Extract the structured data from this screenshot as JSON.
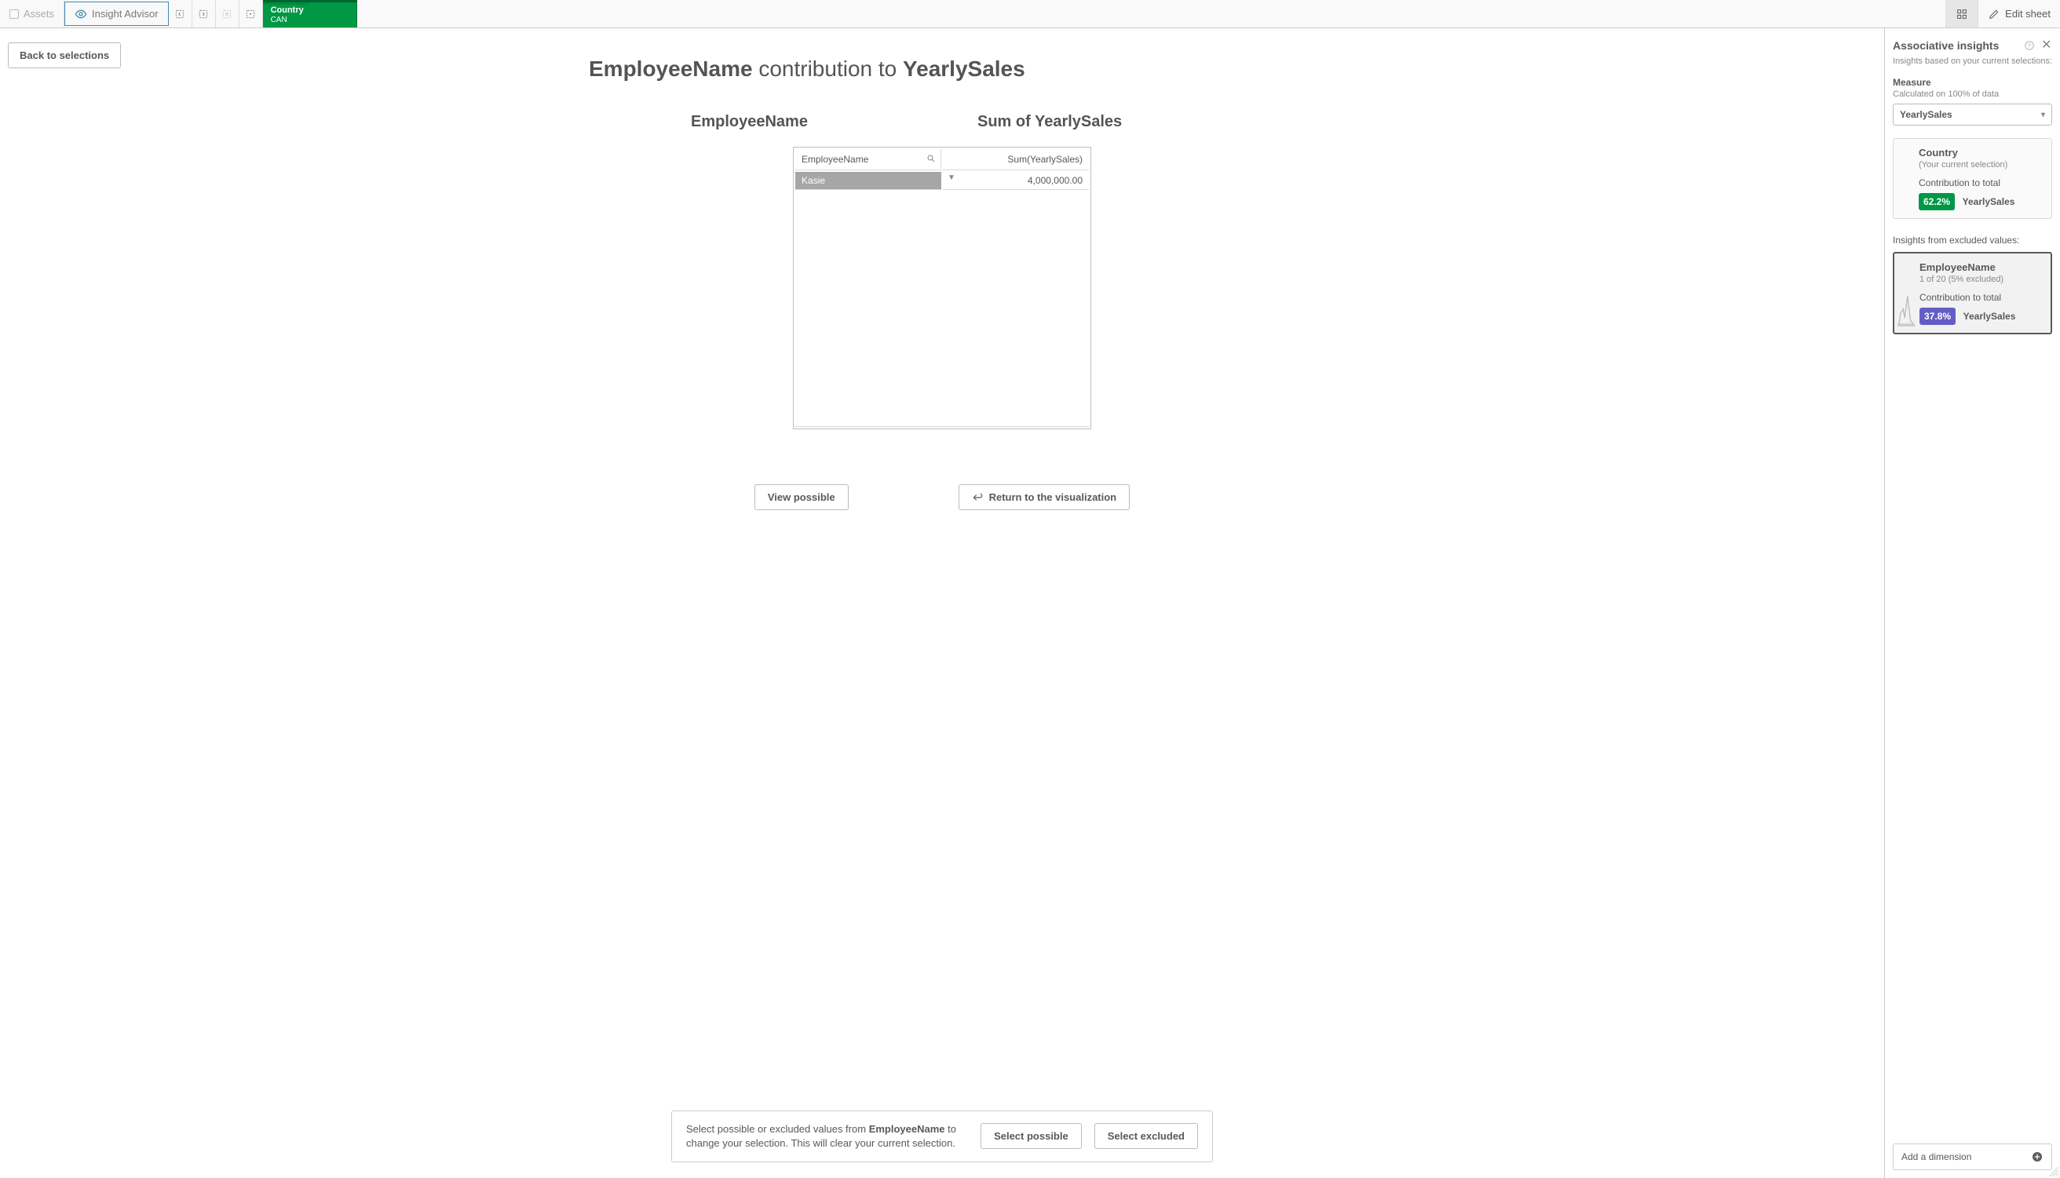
{
  "toolbar": {
    "assets_label": "Assets",
    "insight_label": "Insight Advisor",
    "selection": {
      "field": "Country",
      "value": "CAN"
    },
    "edit_label": "Edit sheet"
  },
  "back_button": "Back to selections",
  "title": {
    "part1": "EmployeeName",
    "part2": " contribution to ",
    "part3": "YearlySales"
  },
  "subheaders": {
    "left": "EmployeeName",
    "right": "Sum of YearlySales"
  },
  "table": {
    "col_dim": "EmployeeName",
    "col_measure": "Sum(YearlySales)",
    "rows": [
      {
        "dim": "Kasie",
        "val": "4,000,000.00"
      }
    ]
  },
  "mid_buttons": {
    "view_possible": "View possible",
    "return": "Return to the visualization"
  },
  "hint": {
    "pre": "Select possible or excluded values from ",
    "strong": "EmployeeName",
    "post": " to change your selection. This will clear your current selection.",
    "select_possible": "Select possible",
    "select_excluded": "Select excluded"
  },
  "panel": {
    "title": "Associative insights",
    "subtitle": "Insights based on your current selections:",
    "measure_label": "Measure",
    "measure_sub": "Calculated on 100% of data",
    "measure_value": "YearlySales",
    "card_current": {
      "title": "Country",
      "meta": "(Your current selection)",
      "contrib_label": "Contribution to total",
      "pct": "62.2%",
      "measure": "YearlySales"
    },
    "excluded_label": "Insights from excluded values:",
    "card_excluded": {
      "title": "EmployeeName",
      "meta": "1 of 20 (5% excluded)",
      "contrib_label": "Contribution to total",
      "pct": "37.8%",
      "measure": "YearlySales"
    },
    "add_dimension": "Add a dimension"
  }
}
